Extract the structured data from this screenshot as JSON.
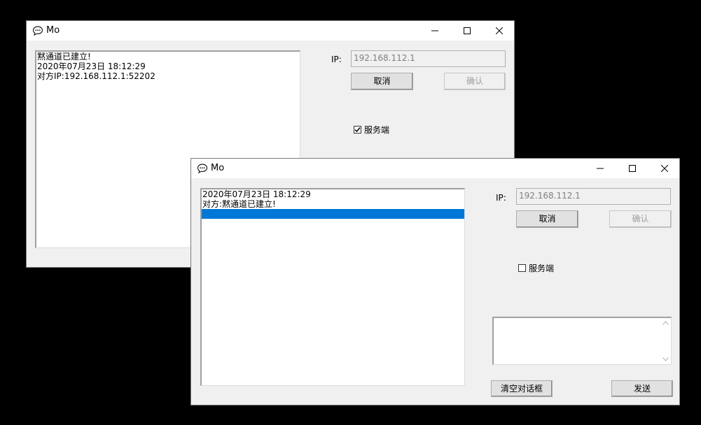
{
  "window1": {
    "title": "Mo",
    "log": [
      "黙通道已建立!",
      "2020年07月23日 18:12:29",
      "对方IP:192.168.112.1:52202"
    ],
    "ip_label": "IP:",
    "ip_value": "192.168.112.1",
    "cancel_label": "取消",
    "confirm_label": "确认",
    "server_label": "服务端",
    "server_checked": true
  },
  "window2": {
    "title": "Mo",
    "log": [
      "2020年07月23日 18:12:29",
      "对方:黙通道已建立!",
      ""
    ],
    "selected_index": 2,
    "ip_label": "IP:",
    "ip_value": "192.168.112.1",
    "cancel_label": "取消",
    "confirm_label": "确认",
    "server_label": "服务端",
    "server_checked": false,
    "message_input": "",
    "clear_label": "清空对话框",
    "send_label": "发送"
  },
  "colors": {
    "selection": "#0078d7",
    "window_bg": "#f0f0f0",
    "desktop": "#000000"
  },
  "icons": [
    "chat-bubble-icon",
    "minimize-icon",
    "maximize-icon",
    "close-icon",
    "check-icon",
    "scroll-up-icon",
    "scroll-down-icon"
  ]
}
